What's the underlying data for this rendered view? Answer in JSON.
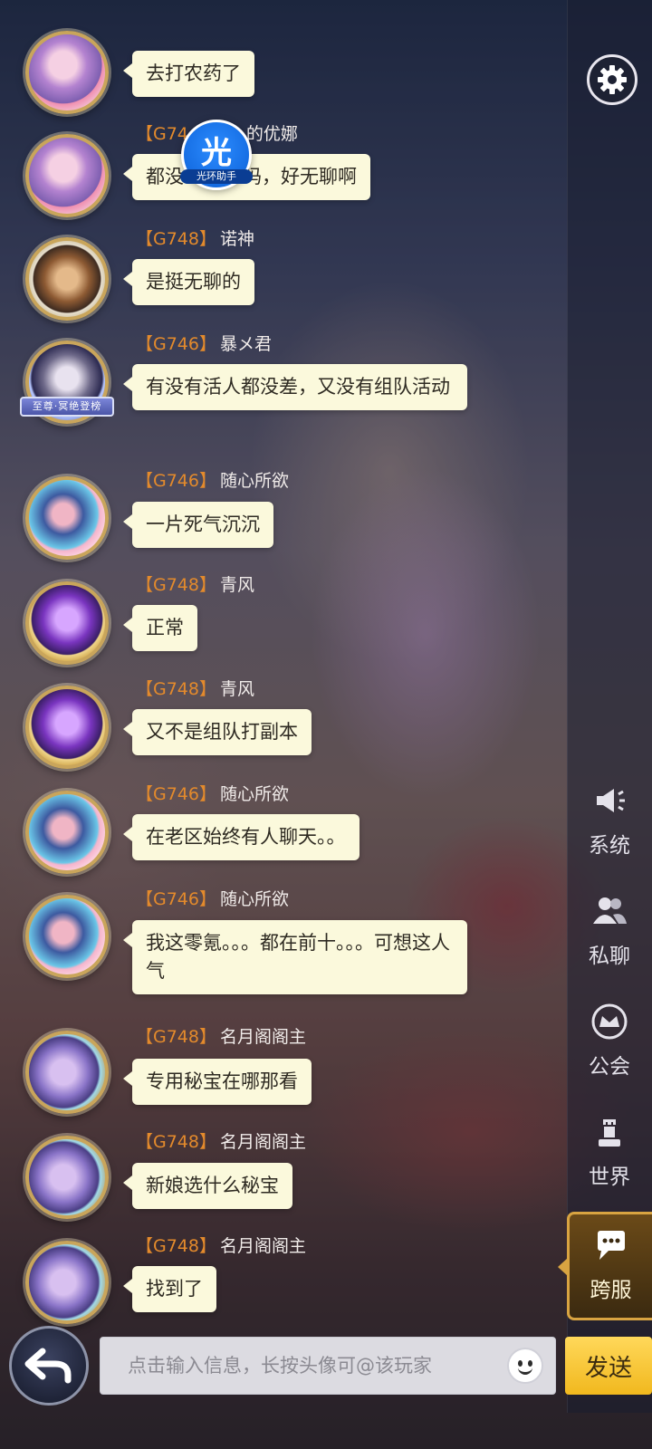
{
  "messages": [
    {
      "server": "",
      "name": "",
      "text": "去打农药了",
      "avatar": "av-pink"
    },
    {
      "server": "【G74",
      "name": "的优娜",
      "text": "都没",
      "text_tail": "了吗，好无聊啊",
      "avatar": "av-pink"
    },
    {
      "server": "【G748】",
      "name": "诺神",
      "text": "是挺无聊的",
      "avatar": "av-brown"
    },
    {
      "server": "【G746】",
      "name": "暴メ君",
      "text": "有没有活人都没差，又没有组队活动",
      "avatar": "av-silver",
      "badge": "至尊·冥绝登榜"
    },
    {
      "server": "【G746】",
      "name": "随心所欲",
      "text": "一片死气沉沉",
      "avatar": "av-blue"
    },
    {
      "server": "【G748】",
      "name": "青风",
      "text": "正常",
      "avatar": "av-purple"
    },
    {
      "server": "【G748】",
      "name": "青风",
      "text": "又不是组队打副本",
      "avatar": "av-purple"
    },
    {
      "server": "【G746】",
      "name": "随心所欲",
      "text": "在老区始终有人聊天。。",
      "avatar": "av-blue"
    },
    {
      "server": "【G746】",
      "name": "随心所欲",
      "text": "我这零氪。。。都在前十。。。可想这人气",
      "avatar": "av-blue"
    },
    {
      "server": "【G748】",
      "name": "名月阁阁主",
      "text": "专用秘宝在哪那看",
      "avatar": "av-lilac"
    },
    {
      "server": "【G748】",
      "name": "名月阁阁主",
      "text": "新娘选什么秘宝",
      "avatar": "av-lilac"
    },
    {
      "server": "【G748】",
      "name": "名月阁阁主",
      "text": "找到了",
      "avatar": "av-lilac"
    }
  ],
  "watermark": {
    "big": "光",
    "small": "光环助手"
  },
  "sidebar": {
    "settings_icon": "gear-icon",
    "tabs": [
      {
        "label": "系统",
        "icon": "megaphone-icon"
      },
      {
        "label": "私聊",
        "icon": "people-icon"
      },
      {
        "label": "公会",
        "icon": "crown-icon"
      },
      {
        "label": "世界",
        "icon": "chess-piece-icon"
      },
      {
        "label": "跨服",
        "icon": "chat-cards-icon",
        "active": true
      }
    ]
  },
  "input": {
    "placeholder": "点击输入信息，长按头像可@该玩家",
    "value": ""
  },
  "send_label": "发送",
  "colors": {
    "bubble": "#fbf9dc",
    "server_tag": "#e38a2c",
    "accent_gold": "#d9a441"
  }
}
